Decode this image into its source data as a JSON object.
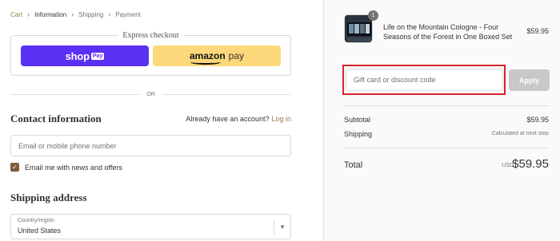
{
  "breadcrumb": {
    "items": [
      "Cart",
      "Information",
      "Shipping",
      "Payment"
    ]
  },
  "express": {
    "title": "Express checkout",
    "shop_label": "shop",
    "shop_badge": "Pay",
    "amazon_label": "amazon",
    "amazon_pay": "pay"
  },
  "divider": {
    "or": "OR"
  },
  "contact": {
    "title": "Contact information",
    "account_prompt": "Already have an account?",
    "login": "Log in",
    "email_placeholder": "Email or mobile phone number",
    "newsletter_label": "Email me with news and offers",
    "newsletter_checked": true
  },
  "shipping": {
    "title": "Shipping address",
    "country_label": "Country/region",
    "country_value": "United States"
  },
  "order": {
    "quantity": "1",
    "product_name": "Life on the Mountain Cologne - Four Seasons of the Forest in One Boxed Set",
    "product_price": "$59.95",
    "discount_placeholder": "Gift card or discount code",
    "apply_label": "Apply",
    "subtotal_label": "Subtotal",
    "subtotal_value": "$59.95",
    "shipping_label": "Shipping",
    "shipping_value": "Calculated at next step",
    "total_label": "Total",
    "currency": "USD",
    "total_value": "$59.95"
  },
  "colors": {
    "link": "#9b7b4b",
    "shop_pay": "#5a31f4",
    "amazon_pay": "#fcd87a",
    "checkbox": "#7d5b3a",
    "highlight": "#d8232a"
  }
}
